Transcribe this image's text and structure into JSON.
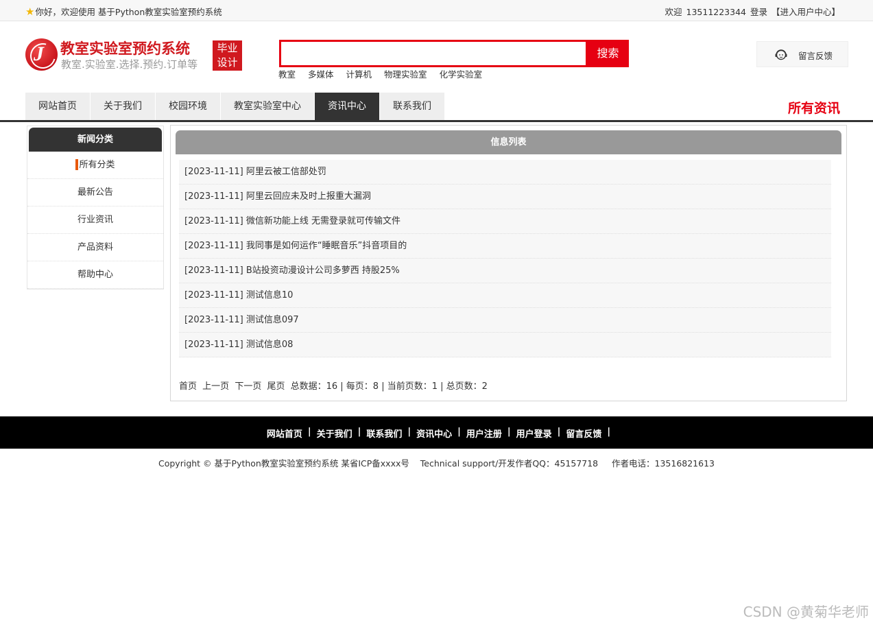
{
  "topbar": {
    "greeting": "你好，欢迎使用 基于Python教室实验室预约系统",
    "welcome": "欢迎",
    "phone": "13511223344",
    "login": "登录",
    "user_center": "【进入用户中心】"
  },
  "header": {
    "title": "教室实验室预约系统",
    "subtitle": "教室.实验室.选择.预约.订单等",
    "badge_line1": "毕业",
    "badge_line2": "设计",
    "logo_letter": "J",
    "search_value": "",
    "search_button": "搜索",
    "hot_words": [
      "教室",
      "多媒体",
      "计算机",
      "物理实验室",
      "化学实验室"
    ],
    "feedback": "留言反馈"
  },
  "nav": {
    "items": [
      "网站首页",
      "关于我们",
      "校园环境",
      "教室实验室中心",
      "资讯中心",
      "联系我们"
    ],
    "active_index": 4,
    "page_title": "所有资讯"
  },
  "sidebar": {
    "title": "新闻分类",
    "items": [
      "所有分类",
      "最新公告",
      "行业资讯",
      "产品资料",
      "帮助中心"
    ]
  },
  "main": {
    "title": "信息列表",
    "news": [
      "[2023-11-11] 阿里云被工信部处罚",
      "[2023-11-11] 阿里云回应未及时上报重大漏洞",
      "[2023-11-11] 微信新功能上线 无需登录就可传输文件",
      "[2023-11-11] 我同事是如何运作“睡眠音乐”抖音项目的",
      "[2023-11-11] B站投资动漫设计公司多萝西 持股25%",
      "[2023-11-11] 测试信息10",
      "[2023-11-11] 测试信息097",
      "[2023-11-11] 测试信息08"
    ],
    "pager": {
      "first": "首页",
      "prev": "上一页",
      "next": "下一页",
      "last": "尾页",
      "summary": "总数据：16 | 每页：8 | 当前页数：1 | 总页数：2"
    }
  },
  "footer": {
    "links": [
      "网站首页",
      "关于我们",
      "联系我们",
      "资讯中心",
      "用户注册",
      "用户登录",
      "留言反馈"
    ],
    "separator": "|",
    "copyright": "Copyright © 基于Python教室实验室预约系统 某省ICP备xxxx号    Technical support/开发作者QQ：45157718     作者电话：13516821613"
  },
  "watermark": "CSDN @黄菊华老师",
  "colors": {
    "brand_red": "#e60012",
    "dark": "#333333",
    "accent_orange": "#e8590c"
  }
}
